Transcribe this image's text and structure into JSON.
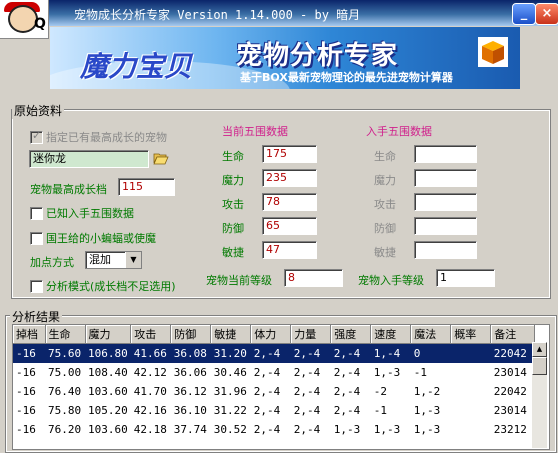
{
  "window": {
    "title": "宠物成长分析专家 Version 1.14.000 - by 暗月",
    "logo_icon": "penguin-mascot-icon",
    "minimize_glyph": "_",
    "close_glyph": "×"
  },
  "banner": {
    "logo_text": "魔力宝贝",
    "title": "宠物分析专家",
    "subtitle": "基于BOX最新宠物理论的最先进宠物计算器",
    "icon": "cube-icon"
  },
  "original": {
    "group_label": "原始资料",
    "specify_max_growth": {
      "label": "指定已有最高成长的宠物",
      "checked": true,
      "enabled": false
    },
    "pet_name": "迷你龙",
    "browse_icon": "folder-open-icon",
    "max_growth_label": "宠物最高成长档",
    "max_growth_value": "115",
    "known_stats": {
      "label": "已知入手五围数据",
      "checked": false
    },
    "king_bat": {
      "label": "国王给的小蝙蝠或使魔",
      "checked": false
    },
    "points_mode_label": "加点方式",
    "points_mode_value": "混加",
    "analysis_mode": {
      "label": "分析模式(成长档不足选用)",
      "checked": false
    }
  },
  "current_stats": {
    "header": "当前五围数据",
    "rows": [
      {
        "label": "生命",
        "value": "175"
      },
      {
        "label": "魔力",
        "value": "235"
      },
      {
        "label": "攻击",
        "value": "78"
      },
      {
        "label": "防御",
        "value": "65"
      },
      {
        "label": "敏捷",
        "value": "47"
      }
    ],
    "level_label": "宠物当前等级",
    "level_value": "8"
  },
  "initial_stats": {
    "header": "入手五围数据",
    "rows": [
      {
        "label": "生命",
        "value": ""
      },
      {
        "label": "魔力",
        "value": ""
      },
      {
        "label": "攻击",
        "value": ""
      },
      {
        "label": "防御",
        "value": ""
      },
      {
        "label": "敏捷",
        "value": ""
      }
    ],
    "level_label": "宠物入手等级",
    "level_value": "1"
  },
  "results": {
    "group_label": "分析结果",
    "columns": [
      "掉档",
      "生命",
      "魔力",
      "攻击",
      "防御",
      "敏捷",
      "体力",
      "力量",
      "强度",
      "速度",
      "魔法",
      "概率",
      "备注"
    ],
    "rows": [
      [
        "-16",
        "75.60",
        "106.80",
        "41.66",
        "36.08",
        "31.20",
        "2,-4",
        "2,-4",
        "2,-4",
        "1,-4",
        "0",
        "",
        "22042"
      ],
      [
        "-16",
        "75.00",
        "108.40",
        "42.12",
        "36.06",
        "30.46",
        "2,-4",
        "2,-4",
        "2,-4",
        "1,-3",
        "-1",
        "",
        "23014"
      ],
      [
        "-16",
        "76.40",
        "103.60",
        "41.70",
        "36.12",
        "31.96",
        "2,-4",
        "2,-4",
        "2,-4",
        "-2",
        "1,-2",
        "",
        "22042"
      ],
      [
        "-16",
        "75.80",
        "105.20",
        "42.16",
        "36.10",
        "31.22",
        "2,-4",
        "2,-4",
        "2,-4",
        "-1",
        "1,-3",
        "",
        "23014"
      ],
      [
        "-16",
        "76.20",
        "103.60",
        "42.18",
        "37.74",
        "30.52",
        "2,-4",
        "2,-4",
        "1,-3",
        "1,-3",
        "1,-3",
        "",
        "23212"
      ]
    ],
    "selected_row": 0
  }
}
